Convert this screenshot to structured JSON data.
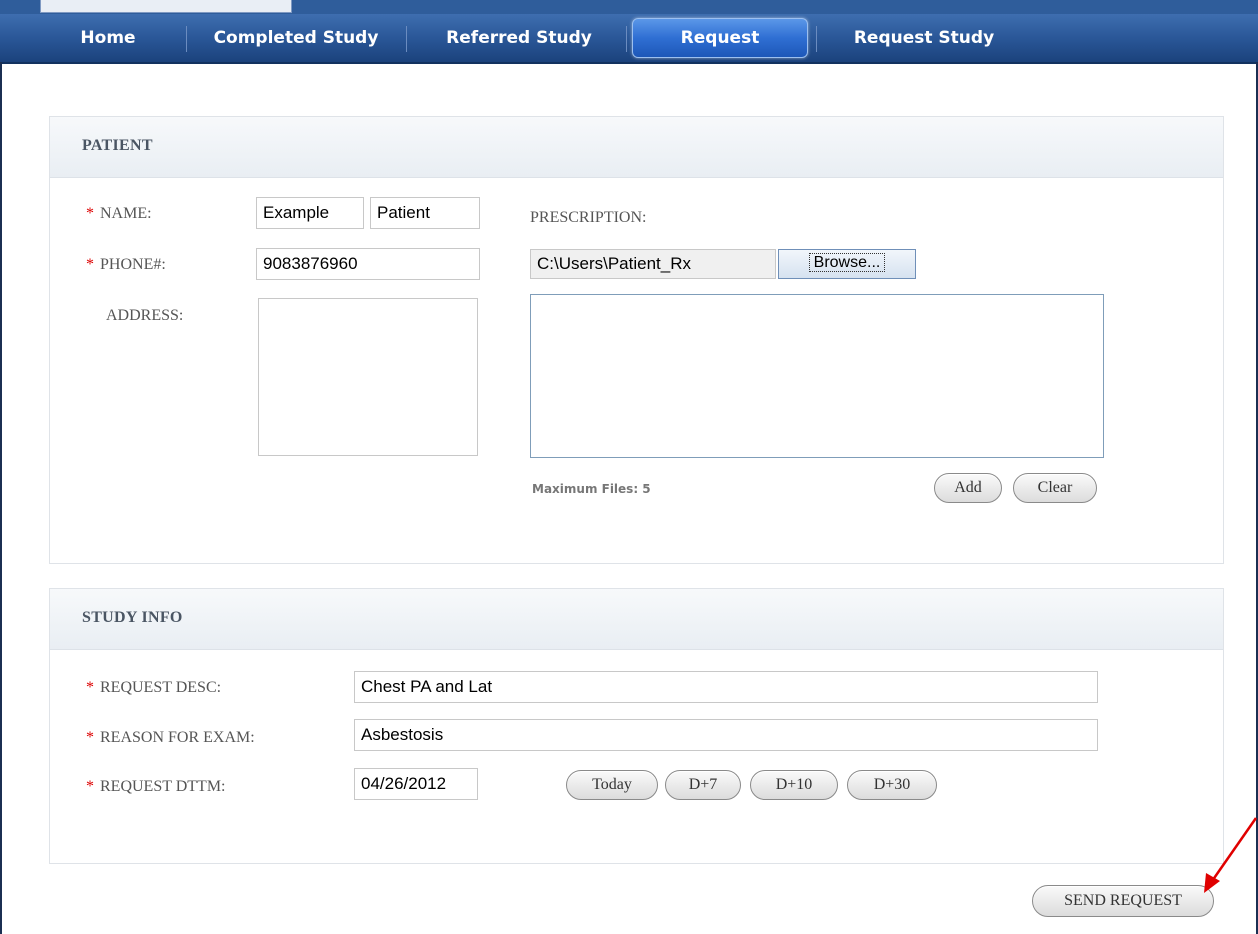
{
  "nav": {
    "items": [
      "Home",
      "Completed Study",
      "Referred Study",
      "Request",
      "Request Study"
    ],
    "active": "Request"
  },
  "patient": {
    "header": "PATIENT",
    "name_label": "NAME:",
    "first_name": "Example",
    "last_name": "Patient",
    "phone_label": "PHONE#:",
    "phone": "9083876960",
    "address_label": "ADDRESS:",
    "prescription_label": "PRESCRIPTION:",
    "file_path": "C:\\Users\\Patient_Rx",
    "browse_label": "Browse...",
    "max_files": "Maximum Files: 5",
    "add_label": "Add",
    "clear_label": "Clear"
  },
  "study": {
    "header": "STUDY INFO",
    "desc_label": "REQUEST DESC:",
    "desc": "Chest PA and Lat",
    "reason_label": "REASON FOR EXAM:",
    "reason": "Asbestosis",
    "dttm_label": "REQUEST DTTM:",
    "dttm": "04/26/2012",
    "today_label": "Today",
    "d7_label": "D+7",
    "d10_label": "D+10",
    "d30_label": "D+30"
  },
  "send_label": "SEND REQUEST",
  "required_marker": "*",
  "colors": {
    "nav_bg": "#2a5798",
    "active_tab": "#2f6fd3",
    "required": "#dd0000",
    "annotation_arrow": "#e00000"
  }
}
